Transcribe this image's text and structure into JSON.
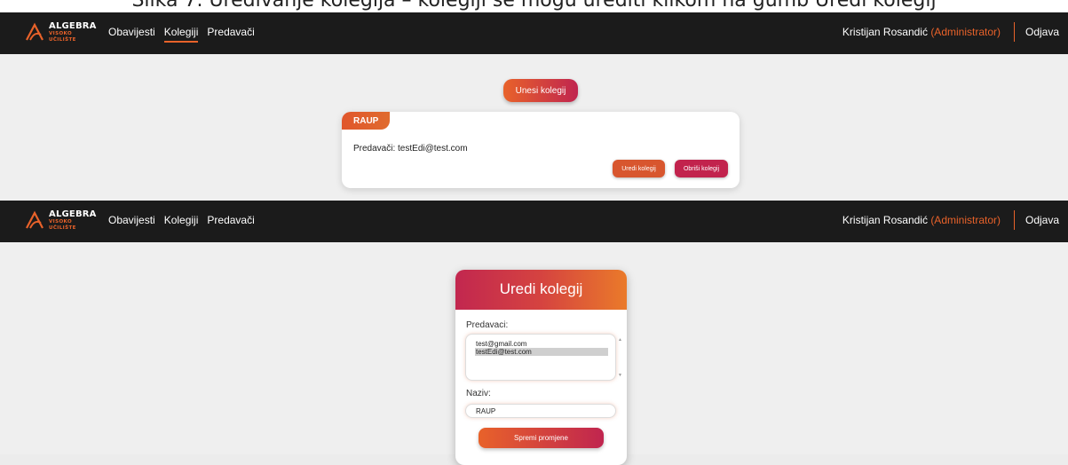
{
  "caption": "Slika 7. Uređivanje kolegija – kolegiji se mogu urediti klikom na gumb Uredi kolegij",
  "logo": {
    "main": "ALGEBRA",
    "sub1": "VISOKO",
    "sub2": "UČILIŠTE"
  },
  "nav": {
    "items": [
      "Obavijesti",
      "Kolegiji",
      "Predavači"
    ]
  },
  "user": {
    "name": "Kristijan Rosandić",
    "role": "(Administrator)",
    "logout": "Odjava"
  },
  "courses_page": {
    "add_button": "Unesi kolegij",
    "course": {
      "name": "RAUP",
      "lecturers": "Predavači: testEdi@test.com",
      "edit_button": "Uredi kolegij",
      "delete_button": "Obriši kolegij"
    }
  },
  "edit_form": {
    "title": "Uredi kolegij",
    "lecturers_label": "Predavaci:",
    "options": [
      "test@gmail.com",
      "testEdi@test.com"
    ],
    "name_label": "Naziv:",
    "name_value": "RAUP",
    "save_button": "Spremi promjene"
  },
  "colors": {
    "accent": "#e8622a",
    "accent2": "#c0254f",
    "navbar": "#1b1b1b"
  }
}
